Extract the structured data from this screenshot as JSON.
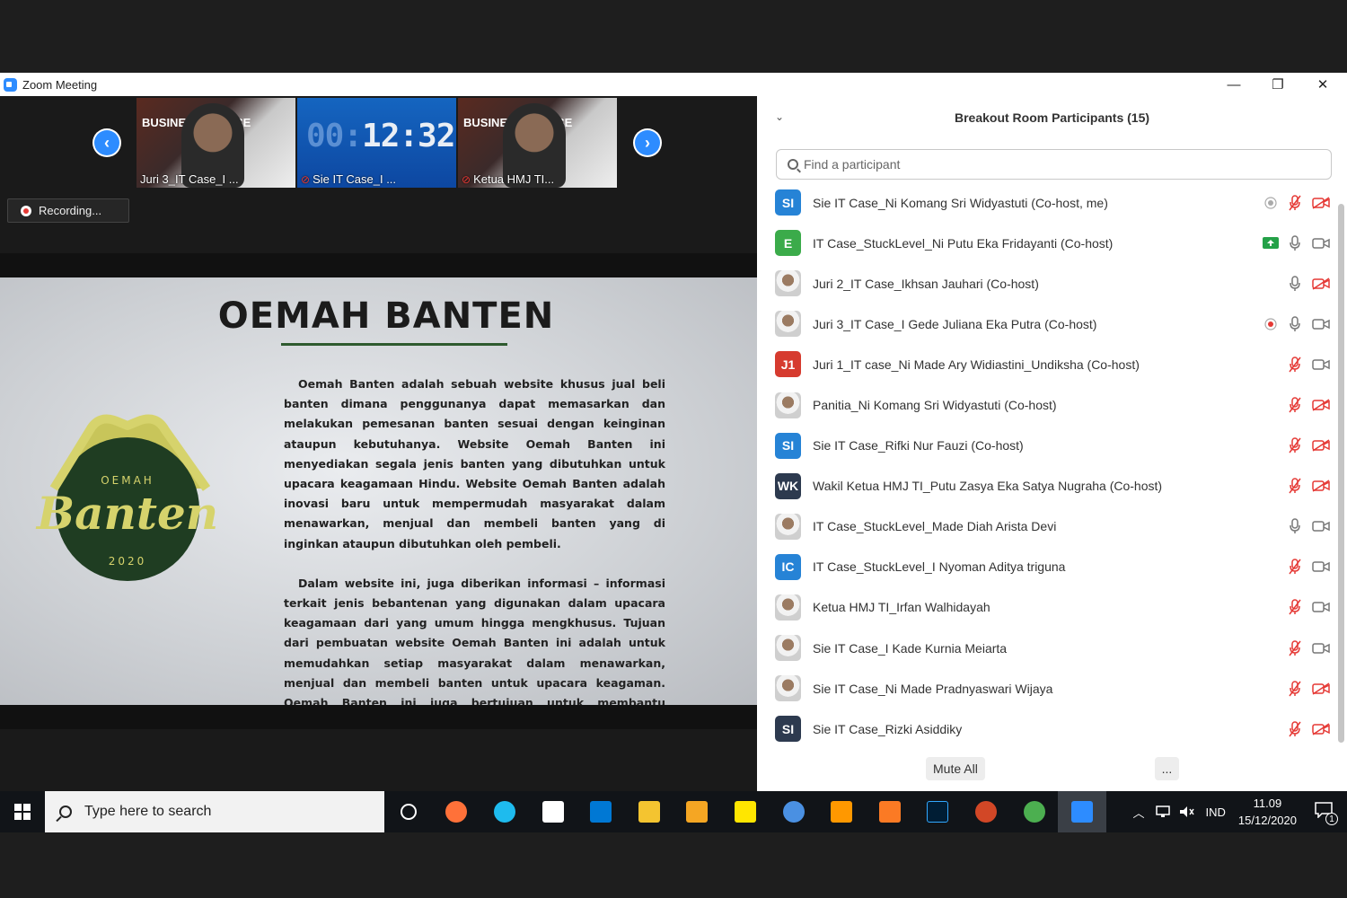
{
  "window": {
    "title": "Zoom Meeting"
  },
  "controls": {
    "minimize": "—",
    "restore": "❐",
    "close": "✕"
  },
  "thumbnails": [
    {
      "name": "Juri 3_IT Case_I ...",
      "kind": "person",
      "banner": "BUSINESS IT CASE"
    },
    {
      "name": "Sie IT Case_I ...",
      "kind": "timer",
      "timer_dim": "00:",
      "timer_main": "12:32"
    },
    {
      "name": "Ketua HMJ TI...",
      "kind": "person",
      "banner": "BUSINESS IT CASE"
    }
  ],
  "recording": {
    "label": "Recording..."
  },
  "slide": {
    "title": "OEMAH BANTEN",
    "logo": {
      "top": "OEMAH",
      "script": "Banten",
      "year": "2020"
    },
    "paragraphs": [
      "Oemah Banten adalah sebuah website khusus jual beli banten dimana penggunanya dapat memasarkan dan melakukan pemesanan banten sesuai dengan keinginan ataupun kebutuhanya. Website Oemah Banten ini menyediakan segala jenis banten yang dibutuhkan untuk upacara keagamaan Hindu. Website Oemah Banten adalah inovasi baru untuk mempermudah masyarakat dalam menawarkan, menjual dan membeli banten yang di inginkan ataupun dibutuhkan oleh pembeli.",
      "Dalam website ini, juga diberikan informasi – informasi terkait jenis bebantenan yang digunakan dalam upacara keagamaan dari yang umum hingga mengkhusus. Tujuan dari pembuatan website Oemah Banten ini adalah untuk memudahkan setiap masyarakat dalam menawarkan, menjual dan membeli banten untuk upacara keagaman. Oemah Banten ini juga bertujuan untuk membantu memberikan peluang bisnis bagi para pemilik UKM ataupun perorangan dalam memasarkan produknya diseluruh wilayah Bali mauapun di luar Bali"
    ]
  },
  "panel": {
    "title": "Breakout Room Participants (15)",
    "search_placeholder": "Find a participant",
    "mute_all": "Mute All",
    "more": "...",
    "participants": [
      {
        "initials": "SI",
        "color": "#2683d6",
        "name": "Sie IT Case_Ni Komang Sri Widyastuti (Co-host, me)",
        "rec": "grey",
        "mic": "off",
        "cam": "off"
      },
      {
        "initials": "E",
        "color": "#3bab4a",
        "name": "IT Case_StuckLevel_Ni Putu Eka Fridayanti (Co-host)",
        "share": true,
        "mic": "on",
        "cam": "on"
      },
      {
        "initials": "",
        "photo": true,
        "name": "Juri 2_IT Case_Ikhsan Jauhari (Co-host)",
        "mic": "on",
        "cam": "off"
      },
      {
        "initials": "",
        "photo": true,
        "name": "Juri 3_IT Case_I Gede Juliana Eka Putra (Co-host)",
        "rec": "red",
        "mic": "on",
        "cam": "on"
      },
      {
        "initials": "J1",
        "color": "#d63b2f",
        "name": "Juri 1_IT case_Ni Made Ary Widiastini_Undiksha (Co-host)",
        "mic": "off",
        "cam": "on"
      },
      {
        "initials": "",
        "photo": true,
        "name": "Panitia_Ni Komang Sri Widyastuti (Co-host)",
        "mic": "off",
        "cam": "off"
      },
      {
        "initials": "SI",
        "color": "#2683d6",
        "name": "Sie IT Case_Rifki Nur Fauzi (Co-host)",
        "mic": "off",
        "cam": "off"
      },
      {
        "initials": "WK",
        "color": "#2d3a4f",
        "name": "Wakil Ketua HMJ TI_Putu Zasya Eka Satya Nugraha (Co-host)",
        "mic": "off",
        "cam": "off"
      },
      {
        "initials": "",
        "photo": true,
        "name": "IT Case_StuckLevel_Made Diah Arista Devi",
        "mic": "on",
        "cam": "on"
      },
      {
        "initials": "IC",
        "color": "#2683d6",
        "name": "IT Case_StuckLevel_I Nyoman Aditya triguna",
        "mic": "off",
        "cam": "on"
      },
      {
        "initials": "",
        "photo": true,
        "name": "Ketua HMJ TI_Irfan Walhidayah",
        "mic": "off",
        "cam": "on"
      },
      {
        "initials": "",
        "photo": true,
        "name": "Sie IT Case_I Kade Kurnia Meiarta",
        "mic": "off",
        "cam": "on"
      },
      {
        "initials": "",
        "photo": true,
        "name": "Sie IT Case_Ni Made Pradnyaswari Wijaya",
        "mic": "off",
        "cam": "off"
      },
      {
        "initials": "SI",
        "color": "#2d3a4f",
        "name": "Sie IT Case_Rizki Asiddiky",
        "mic": "off",
        "cam": "off"
      }
    ]
  },
  "taskbar": {
    "search_placeholder": "Type here to search",
    "apps": [
      "task-view",
      "firefox",
      "internet-explorer",
      "store",
      "mail",
      "file-explorer",
      "media-player",
      "sticky-notes",
      "chromium",
      "sublime-text",
      "xampp",
      "photoshop",
      "powerpoint",
      "chrome",
      "zoom"
    ],
    "language": "IND",
    "time": "11.09",
    "date": "15/12/2020",
    "notifications": "1"
  },
  "colors": {
    "accent": "#2d8cff",
    "muted_red": "#e53935",
    "share_green": "#24a148"
  }
}
